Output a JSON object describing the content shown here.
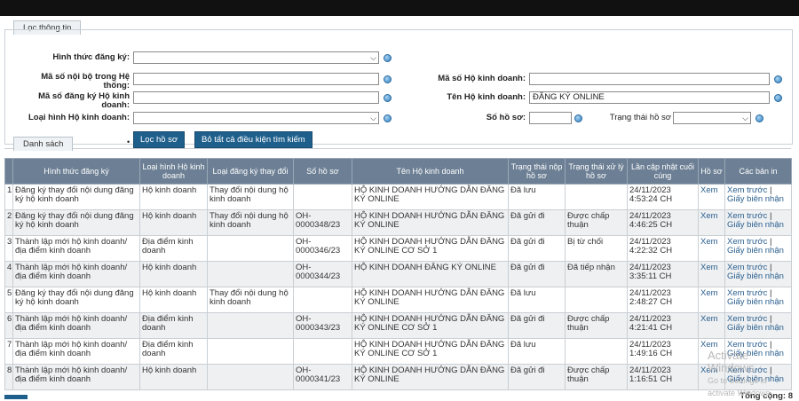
{
  "filter": {
    "tab_label": "Lọc thông tin",
    "hinh_thuc_label": "Hình thức đăng ký:",
    "hinh_thuc_value": "",
    "ma_so_noi_bo_label": "Mã số nội bộ trong Hệ thống:",
    "ma_so_noi_bo_value": "",
    "ma_so_dang_ky_label": "Mã số đăng ký Hộ kinh doanh:",
    "ma_so_dang_ky_value": "",
    "loai_hinh_label": "Loại hình Hộ kinh doanh:",
    "loai_hinh_value": "",
    "ma_so_hkd_label": "Mã số Hộ kinh doanh:",
    "ma_so_hkd_value": "",
    "ten_hkd_label": "Tên Hộ kinh doanh:",
    "ten_hkd_value": "ĐĂNG KÝ ONLINE",
    "so_ho_so_label": "Số hồ sơ:",
    "so_ho_so_value": "",
    "trang_thai_label": "Trạng thái hồ sơ",
    "trang_thai_value": "",
    "filter_button": "Lọc hồ sơ",
    "clear_button": "Bỏ tất cả điều kiện tìm kiếm"
  },
  "list": {
    "tab_label": "Danh sách",
    "dot": "•",
    "headers": [
      "",
      "Hình thức đăng ký",
      "Loại hình Hộ kinh doanh",
      "Loại đăng ký thay đổi",
      "Số hồ sơ",
      "Tên Hộ kinh doanh",
      "Trạng thái nộp hồ sơ",
      "Trạng thái xử lý hồ sơ",
      "Lần cập nhật cuối cùng",
      "Hồ sơ",
      "Các bản in"
    ],
    "view_label": "Xem",
    "print_preview": "Xem trước",
    "print_sep": " | ",
    "print_receipt": "Giấy biên nhận",
    "rows": [
      {
        "n": "1",
        "form": "Đăng ký thay đổi nội dung đăng ký hộ kinh doanh",
        "type": "Hộ kinh doanh",
        "change": "Thay đổi nội dung hộ kinh doanh",
        "code": "",
        "name": "HỘ KINH DOANH HƯỚNG DẪN ĐĂNG KÝ ONLINE",
        "submit": "Đã lưu",
        "process": "",
        "updated": "24/11/2023 4:53:24 CH"
      },
      {
        "n": "2",
        "form": "Đăng ký thay đổi nội dung đăng ký hộ kinh doanh",
        "type": "Hộ kinh doanh",
        "change": "Thay đổi nội dung hộ kinh doanh",
        "code": "OH-0000348/23",
        "name": "HỘ KINH DOANH HƯỚNG DẪN ĐĂNG KÝ ONLINE",
        "submit": "Đã gửi đi",
        "process": "Được chấp thuận",
        "updated": "24/11/2023 4:46:25 CH"
      },
      {
        "n": "3",
        "form": "Thành lập mới hộ kinh doanh/ địa điểm kinh doanh",
        "type": "Địa điểm kinh doanh",
        "change": "",
        "code": "OH-0000346/23",
        "name": "HỘ KINH DOANH HƯỚNG DẪN ĐĂNG KÝ ONLINE CƠ SỞ 1",
        "submit": "Đã gửi đi",
        "process": "Bị từ chối",
        "updated": "24/11/2023 4:22:32 CH"
      },
      {
        "n": "4",
        "form": "Thành lập mới hộ kinh doanh/ địa điểm kinh doanh",
        "type": "Hộ kinh doanh",
        "change": "",
        "code": "OH-0000344/23",
        "name": "HỘ KINH DOANH ĐĂNG KÝ ONLINE",
        "submit": "Đã gửi đi",
        "process": "Đã tiếp nhận",
        "updated": "24/11/2023 3:35:11 CH"
      },
      {
        "n": "5",
        "form": "Đăng ký thay đổi nội dung đăng ký hộ kinh doanh",
        "type": "Hộ kinh doanh",
        "change": "Thay đổi nội dung hộ kinh doanh",
        "code": "",
        "name": "HỘ KINH DOANH HƯỚNG DẪN ĐĂNG KÝ ONLINE",
        "submit": "Đã lưu",
        "process": "",
        "updated": "24/11/2023 2:48:27 CH"
      },
      {
        "n": "6",
        "form": "Thành lập mới hộ kinh doanh/ địa điểm kinh doanh",
        "type": "Địa điểm kinh doanh",
        "change": "",
        "code": "OH-0000343/23",
        "name": "HỘ KINH DOANH HƯỚNG DẪN ĐĂNG KÝ ONLINE CƠ SỞ 1",
        "submit": "Đã gửi đi",
        "process": "Được chấp thuận",
        "updated": "24/11/2023 4:21:41 CH"
      },
      {
        "n": "7",
        "form": "Thành lập mới hộ kinh doanh/ địa điểm kinh doanh",
        "type": "Địa điểm kinh doanh",
        "change": "",
        "code": "",
        "name": "HỘ KINH DOANH HƯỚNG DẪN ĐĂNG KÝ ONLINE CƠ SỞ 1",
        "submit": "Đã lưu",
        "process": "",
        "updated": "24/11/2023 1:49:16 CH"
      },
      {
        "n": "8",
        "form": "Thành lập mới hộ kinh doanh/ địa điểm kinh doanh",
        "type": "Hộ kinh doanh",
        "change": "",
        "code": "OH-0000341/23",
        "name": "HỘ KINH DOANH HƯỚNG DẪN ĐĂNG KÝ ONLINE",
        "submit": "Đã gửi đi",
        "process": "Được chấp thuận",
        "updated": "24/11/2023 1:16:51 CH"
      }
    ],
    "total": "Tổng cộng: 8"
  },
  "watermark": {
    "line1": "Activate Windows",
    "line2": "Go to Settings to activate Windows."
  }
}
